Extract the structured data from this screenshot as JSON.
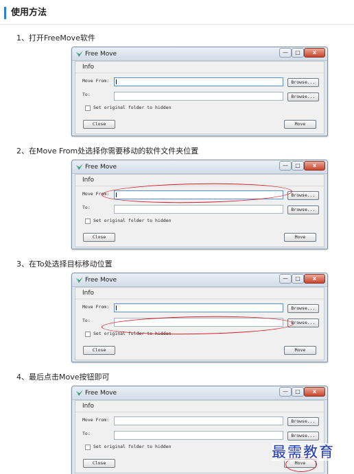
{
  "header": {
    "title": "使用方法",
    "accent": "#2b7de1"
  },
  "steps": [
    {
      "text": "1、打开FreeMove软件"
    },
    {
      "text": "2、在Move From处选择你需要移动的软件文件夹位置"
    },
    {
      "text": "3、在To处选择目标移动位置"
    },
    {
      "text": "4、最后点击Move按钮即可"
    }
  ],
  "app": {
    "title": "Free Move",
    "menu": "Info",
    "move_from_label": "Move From:",
    "to_label": "To:",
    "browse_label": "Browse...",
    "checkbox_label": "Set original folder to hidden",
    "close_label": "Close",
    "move_label": "Move",
    "min_glyph": "—",
    "max_glyph": "□",
    "close_glyph": "x"
  },
  "annotation_color": "#d0202a",
  "watermark": {
    "text": "最需教育",
    "color": "#1f39b8"
  }
}
